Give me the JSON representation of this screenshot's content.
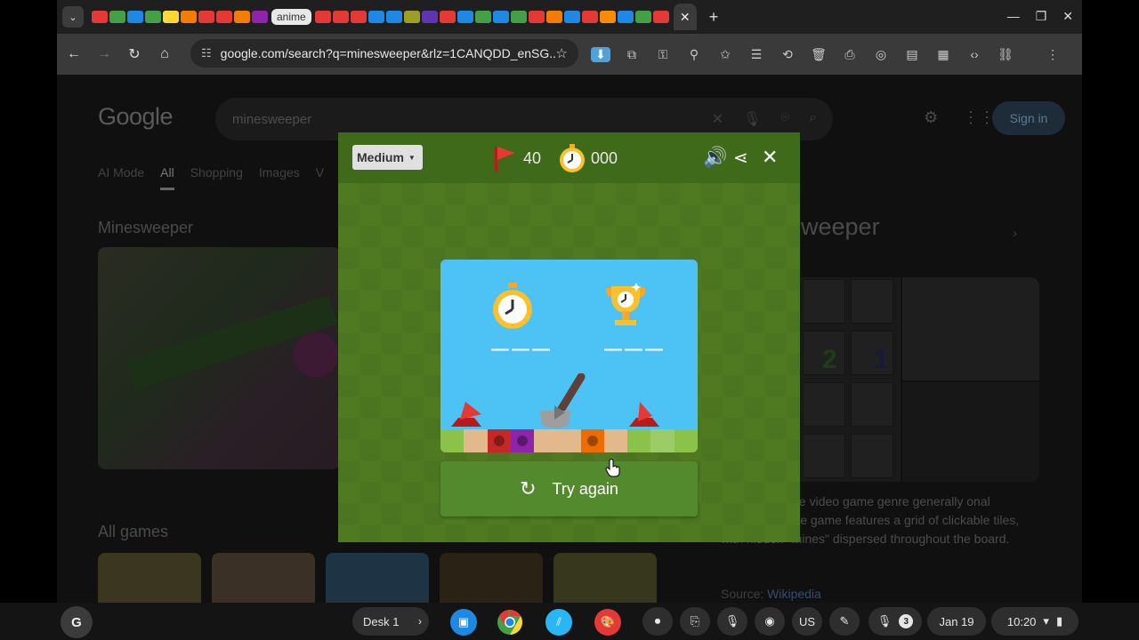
{
  "browser": {
    "tab_chip_label": "anime",
    "active_tab_close": "✕",
    "new_tab": "+",
    "window_controls": [
      "—",
      "❐",
      "✕"
    ],
    "url": "google.com/search?q=minesweeper&rlz=1CANQDD_enSG...",
    "tab_favicon_colors": [
      "#e53935",
      "#43a047",
      "#1e88e5",
      "#43a047",
      "#fdd835",
      "#f57c00",
      "#e53935",
      "#e53935",
      "#f57c00",
      "#8e24aa",
      "#e53935",
      "#e53935",
      "#e53935",
      "#1e88e5",
      "#1e88e5",
      "#9e9d24",
      "#5e35b1",
      "#e53935",
      "#1e88e5",
      "#43a047",
      "#1e88e5",
      "#43a047",
      "#e53935",
      "#f57c00",
      "#1e88e5",
      "#e53935",
      "#fb8c00",
      "#1e88e5",
      "#43a047",
      "#e53935"
    ]
  },
  "google": {
    "logo": "Google",
    "query": "minesweeper",
    "sign_in": "Sign in",
    "tabs": [
      "AI Mode",
      "All",
      "Shopping",
      "Images",
      "V"
    ],
    "active_tab": "All",
    "section_title": "Minesweeper",
    "all_games_title": "All games",
    "knowledge_title": "weeper",
    "kp_numbers": [
      "2",
      "1"
    ],
    "description": "s a logic puzzle video game genre generally onal computers. The game features a grid of clickable tiles, with hidden \"mines\" dispersed throughout the board.",
    "source_label": "Source:",
    "source_link": "Wikipedia"
  },
  "minesweeper": {
    "difficulty": "Medium",
    "flags_remaining": "40",
    "time": "000",
    "current_score": "———",
    "best_score": "———",
    "try_again": "Try again",
    "ground_colors": [
      "#8bc34a",
      "#e2b98a",
      "#c62828",
      "#8e24aa",
      "#e2b98a",
      "#e2b98a",
      "#ef6c00",
      "#e2b98a",
      "#8bc34a",
      "#9ccc65",
      "#8bc34a"
    ],
    "ground_dots": [
      false,
      false,
      true,
      true,
      false,
      false,
      true,
      false,
      false,
      false,
      false
    ]
  },
  "shelf": {
    "launcher": "G",
    "desk": "Desk 1",
    "ime": "US",
    "notif_count": "3",
    "date": "Jan 19",
    "time": "10:20"
  }
}
